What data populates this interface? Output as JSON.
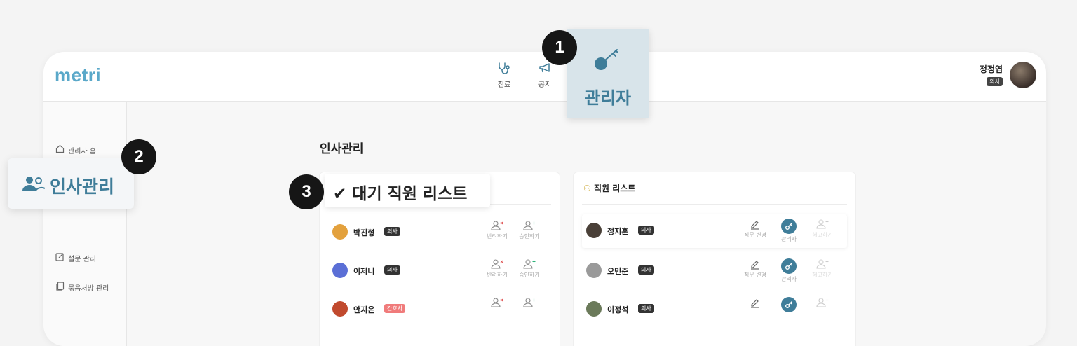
{
  "app": {
    "logo": "metri"
  },
  "nav": {
    "items": [
      {
        "label": "진료",
        "icon": "stethoscope-icon"
      },
      {
        "label": "공지",
        "icon": "megaphone-icon"
      }
    ],
    "admin_label": "관리자"
  },
  "user": {
    "name": "정정엽",
    "role": "의사"
  },
  "sidebar": {
    "items": [
      {
        "label": "관리자 홈",
        "icon": "home-icon"
      },
      {
        "label": "인사관리",
        "icon": "users-icon"
      },
      {
        "label": "설문 관리",
        "icon": "edit-icon"
      },
      {
        "label": "묶음처방 관리",
        "icon": "copy-icon"
      }
    ]
  },
  "page": {
    "title": "인사관리"
  },
  "callouts": {
    "one": "1",
    "two": "2",
    "three": "3"
  },
  "waiting": {
    "title": "✔ 대기 직원 리스트",
    "reject_label": "반려하기",
    "approve_label": "승인하기",
    "rows": [
      {
        "name": "박진형",
        "role": "의사"
      },
      {
        "name": "이제니",
        "role": "의사"
      },
      {
        "name": "안지은",
        "role": "간호사"
      }
    ]
  },
  "staff": {
    "title": "직원 리스트",
    "change_label": "직무 변경",
    "admin_label": "관리자",
    "fire_label": "해고하기",
    "rows": [
      {
        "name": "정지훈",
        "role": "의사"
      },
      {
        "name": "오민준",
        "role": "의사"
      },
      {
        "name": "이정석",
        "role": "의사"
      }
    ]
  },
  "colors": {
    "accent": "#3f7d99",
    "logo": "#5aa8c9",
    "nurse_tag": "#f07b7b"
  }
}
